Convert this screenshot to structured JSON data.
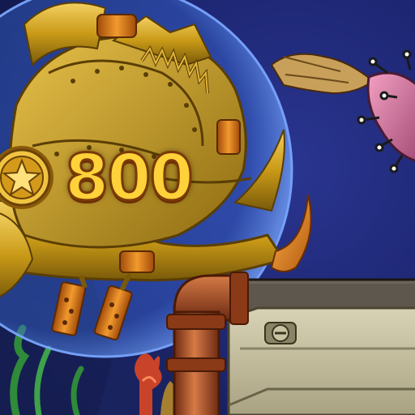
{
  "reward": {
    "value": "800",
    "icon": "star-coin-icon"
  },
  "scene": {
    "background_color": "#1f2a78",
    "bubble_color": "#3b66c9",
    "boss_fish": "golden-mechanical-fish",
    "enemy_fish": "pink-spiky-fish",
    "cannon_panel": "steampunk-pipe-panel"
  },
  "colors": {
    "gold": "#d4a21a",
    "gold_dark": "#7a5a0a",
    "copper": "#b5542a",
    "steel": "#4a4640",
    "panel_tan": "#c9c3a3"
  }
}
